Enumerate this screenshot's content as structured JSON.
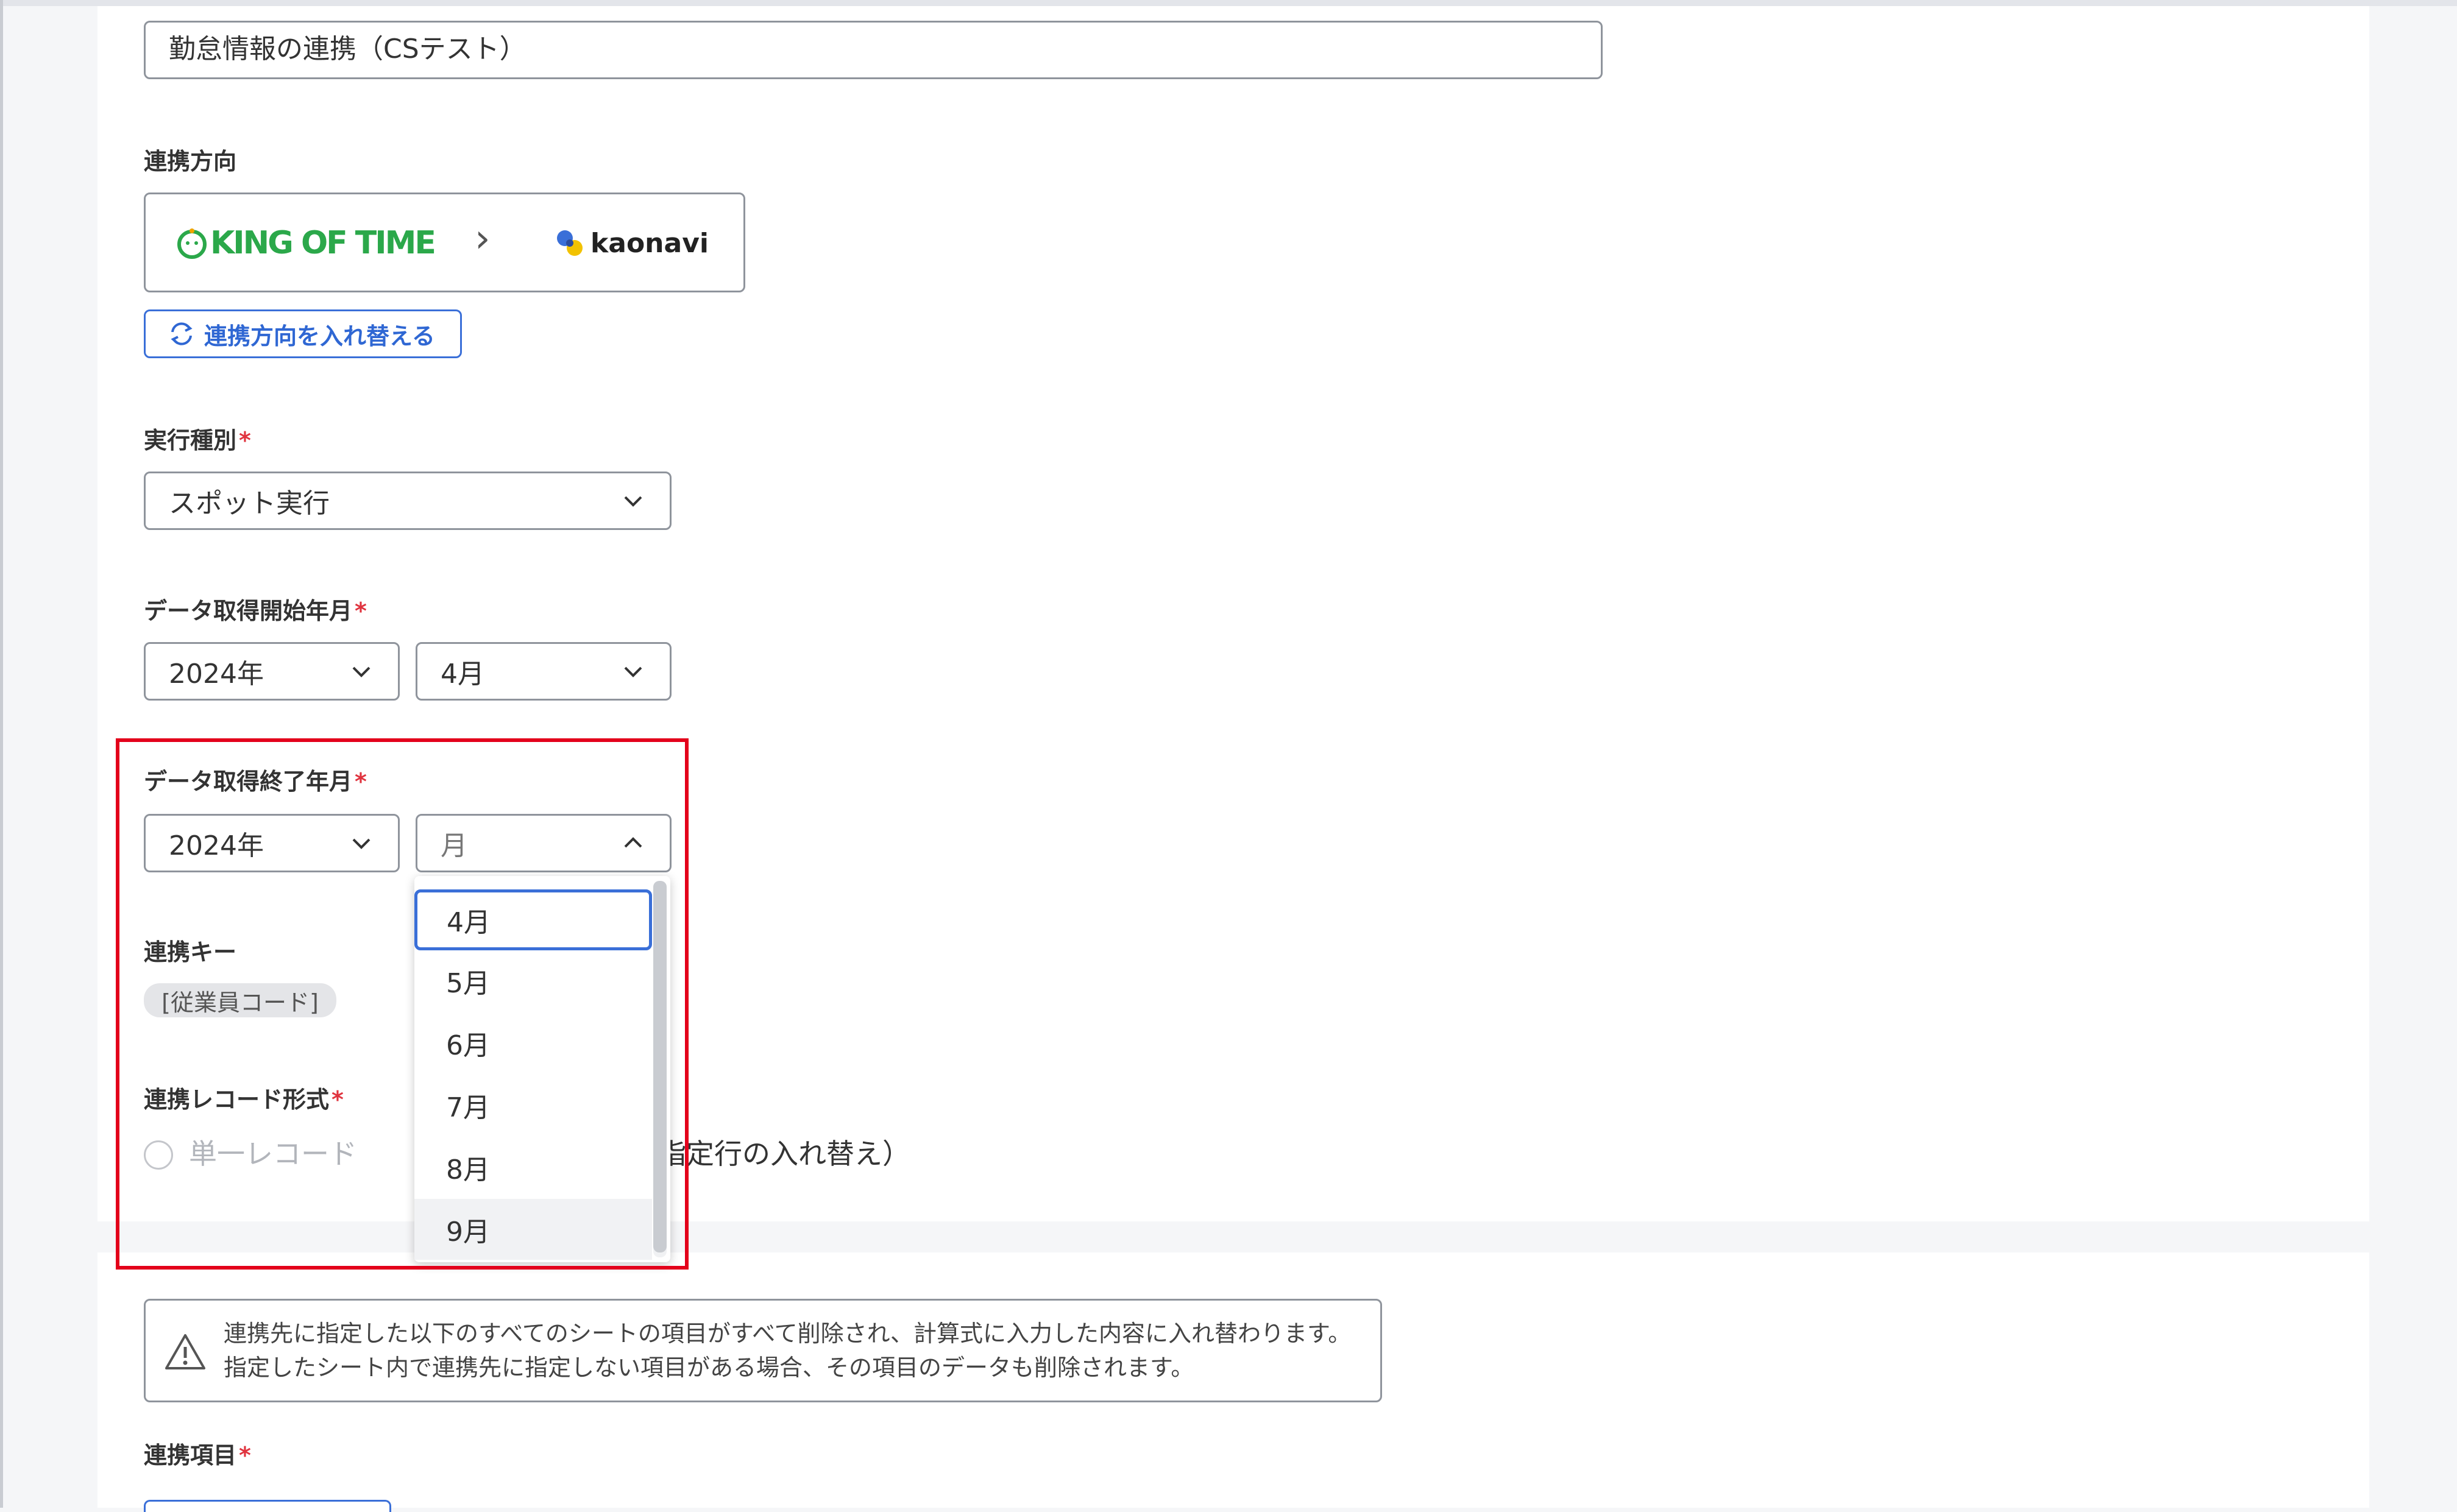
{
  "form": {
    "name_value": "勤怠情報の連携（CSテスト）",
    "direction": {
      "label": "連携方向",
      "source_logo_text": "KING OF TIME",
      "target_logo_text": "kaonavi",
      "arrow": "›",
      "swap_label": "連携方向を入れ替える"
    },
    "execution_type": {
      "label": "実行種別",
      "value": "スポット実行"
    },
    "start_month": {
      "label": "データ取得開始年月",
      "year": "2024年",
      "month": "4月"
    },
    "end_month": {
      "label": "データ取得終了年月",
      "year": "2024年",
      "month_placeholder": "月",
      "options": [
        "4月",
        "5月",
        "6月",
        "7月",
        "8月",
        "9月"
      ]
    },
    "link_key": {
      "label": "連携キー",
      "tag": "[従業員コード]"
    },
    "record_format": {
      "label": "連携レコード形式",
      "option_single": "単一レコード",
      "option_partial": "指定行の入れ替え）"
    },
    "warning": {
      "line1": "連携先に指定した以下のすべてのシートの項目がすべて削除され、計算式に入力した内容に入れ替わります。",
      "line2": "指定したシート内で連携先に指定しない項目がある場合、その項目のデータも削除されます。"
    },
    "link_items": {
      "label": "連携項目"
    },
    "required_mark": "*"
  },
  "colors": {
    "accent_blue": "#3a6fd8",
    "highlight_red": "#e3001b",
    "required_red": "#e0343f",
    "king_green": "#2ba84a"
  }
}
